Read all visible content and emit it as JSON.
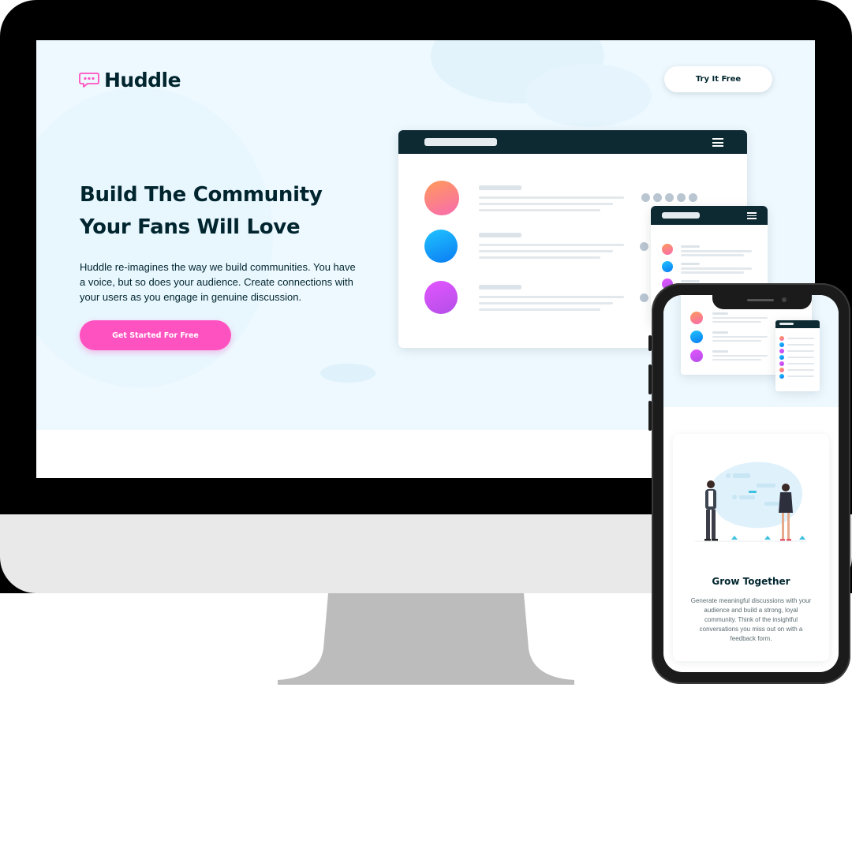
{
  "brand": {
    "name": "Huddle",
    "accent": "#ff52c1",
    "dark": "#00252e",
    "hero_bg": "#eef9ff"
  },
  "header": {
    "logo_text": "Huddle",
    "try_label": "Try It Free"
  },
  "hero": {
    "title_line1": "Build The Community",
    "title_line2": "Your Fans Will Love",
    "description": "Huddle re-imagines the way we build communities. You have a voice, but so does your audience. Create connections with your users as you engage in genuine discussion.",
    "cta_label": "Get Started For Free"
  },
  "feature_card": {
    "title": "Grow Together",
    "description": "Generate meaningful discussions with your audience and build a strong, loyal community. Think of the insightful conversations you miss out on with a feedback form."
  },
  "icons": [
    "chat-bubble-logo-icon",
    "hamburger-menu-icon"
  ]
}
